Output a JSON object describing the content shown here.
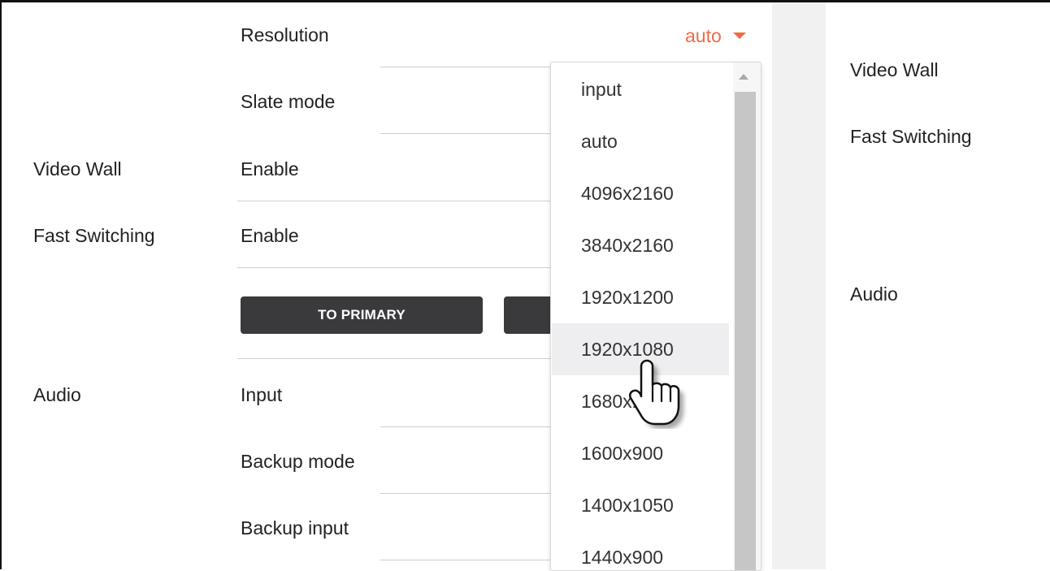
{
  "settings": {
    "resolution_label": "Resolution",
    "resolution_value": "auto",
    "slate_mode_label": "Slate mode",
    "video_wall_section": "Video Wall",
    "video_wall_enable": "Enable",
    "fast_switching_section": "Fast Switching",
    "fast_switching_enable": "Enable",
    "to_primary_button": "TO PRIMARY",
    "audio_section": "Audio",
    "input_label": "Input",
    "backup_mode_label": "Backup mode",
    "backup_input_label": "Backup input"
  },
  "side_nav": {
    "items": [
      "Video Wall",
      "Fast Switching",
      "Audio"
    ]
  },
  "resolution_dropdown": {
    "options": [
      "input",
      "auto",
      "4096x2160",
      "3840x2160",
      "1920x1200",
      "1920x1080",
      "1680x1050",
      "1600x900",
      "1400x1050",
      "1440x900"
    ],
    "hovered": "1920x1080"
  },
  "colors": {
    "accent": "#ef6c45",
    "button": "#3a3a3c"
  },
  "icons": {
    "dropdown_caret": "caret-down-icon",
    "pointer": "hand-pointer-icon"
  }
}
